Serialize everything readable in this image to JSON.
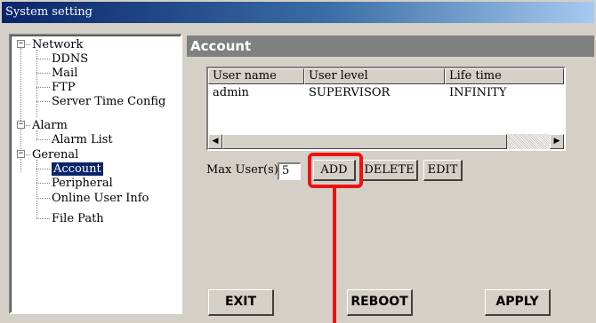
{
  "window": {
    "title": "System setting"
  },
  "tree": {
    "groups": [
      {
        "label": "Network",
        "expander": "−",
        "children": [
          "DDNS",
          "Mail",
          "FTP",
          "Server Time Config"
        ]
      },
      {
        "label": "Alarm",
        "expander": "−",
        "children": [
          "Alarm List"
        ]
      },
      {
        "label": "Gerenal",
        "expander": "−",
        "children": [
          "Account",
          "Peripheral",
          "Online User Info",
          "File Path"
        ]
      }
    ],
    "selected": "Account"
  },
  "panel": {
    "title": "Account",
    "list": {
      "columns": [
        "User name",
        "User level",
        "Life time"
      ],
      "rows": [
        [
          "admin",
          "SUPERVISOR",
          "INFINITY"
        ]
      ],
      "scroll_left": "◀",
      "scroll_right": "▶"
    },
    "max_users": {
      "label": "Max User(s) :",
      "value": "5"
    },
    "buttons": {
      "add": "ADD",
      "delete": "DELETE",
      "edit": "EDIT"
    }
  },
  "footer": {
    "exit": "EXIT",
    "reboot": "REBOOT",
    "apply": "APPLY"
  },
  "colors": {
    "highlight": "#ee1111",
    "title_gradient_start": "#0a246a",
    "selection": "#0a246a"
  }
}
